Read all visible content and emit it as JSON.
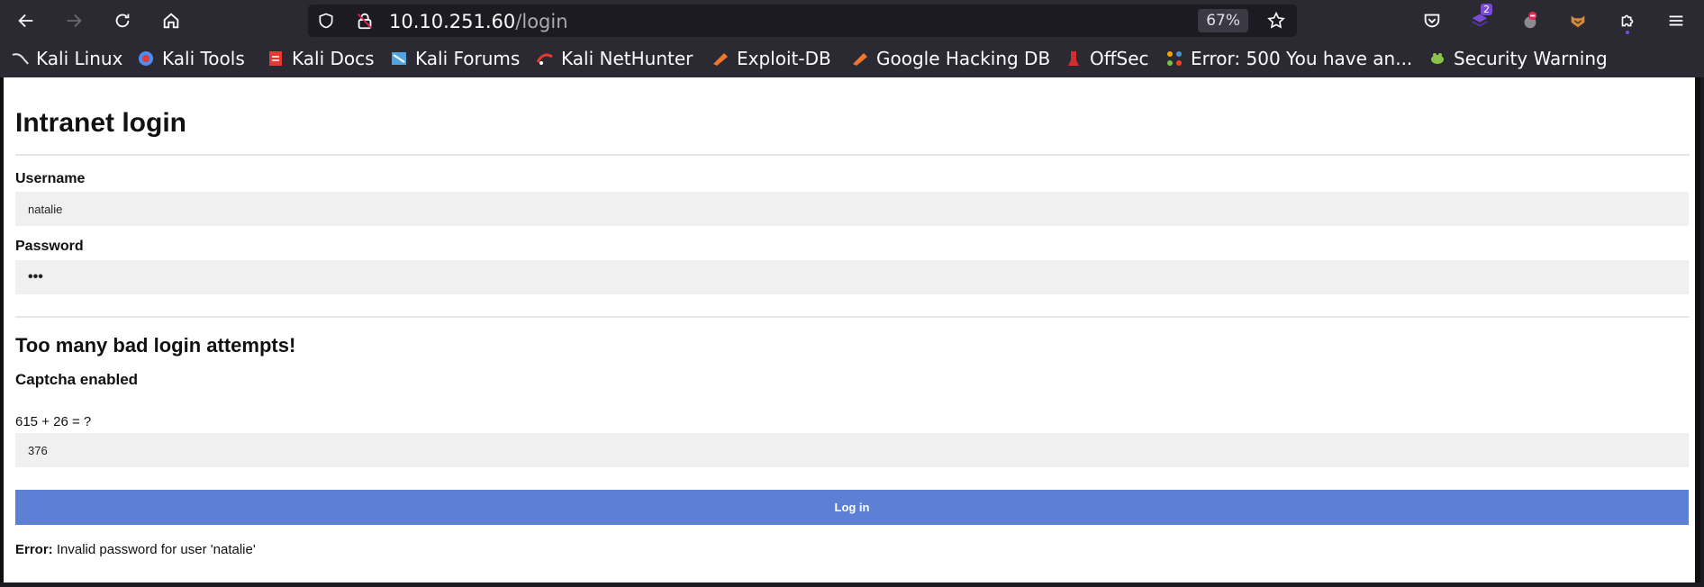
{
  "browser": {
    "url_host": "10.10.251.60",
    "url_path": "/login",
    "zoom": "67%",
    "extensions_badge": "2",
    "bookmarks": [
      {
        "label": "Kali Linux",
        "icon": "kali-dragon-icon",
        "color": "#e0e0e0"
      },
      {
        "label": "Kali Tools",
        "icon": "kali-tools-icon",
        "color": "#4c8cf5"
      },
      {
        "label": "Kali Docs",
        "icon": "kali-docs-icon",
        "color": "#e53935"
      },
      {
        "label": "Kali Forums",
        "icon": "kali-forums-icon",
        "color": "#4fa3e0"
      },
      {
        "label": "Kali NetHunter",
        "icon": "nethunter-icon",
        "color": "#e53935"
      },
      {
        "label": "Exploit-DB",
        "icon": "exploit-db-icon",
        "color": "#f0772b"
      },
      {
        "label": "Google Hacking DB",
        "icon": "ghdb-icon",
        "color": "#f0772b"
      },
      {
        "label": "OffSec",
        "icon": "offsec-icon",
        "color": "#d32f2f"
      },
      {
        "label": "Error: 500 You have an...",
        "icon": "joomla-icon",
        "color": "#f4a300"
      },
      {
        "label": "Security Warning",
        "icon": "security-warning-icon",
        "color": "#8bc34a"
      }
    ]
  },
  "page": {
    "title": "Intranet login",
    "username_label": "Username",
    "username_value": "natalie",
    "password_label": "Password",
    "password_value": "•••",
    "warning_heading": "Too many bad login attempts!",
    "captcha_heading": "Captcha enabled",
    "captcha_question": "615 + 26 = ?",
    "captcha_value": "376",
    "login_button": "Log in",
    "error_prefix": "Error:",
    "error_message": "Invalid password for user 'natalie'"
  }
}
